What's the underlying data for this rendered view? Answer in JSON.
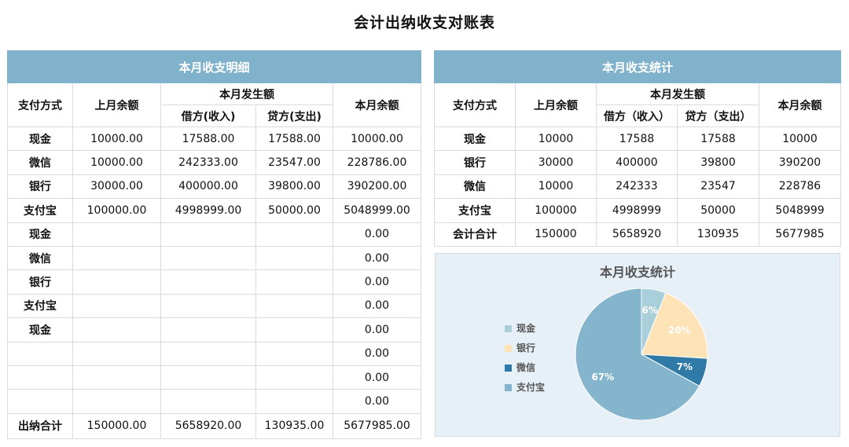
{
  "title": "会计出纳收支对账表",
  "left_table": {
    "band": "本月收支明细",
    "headers": {
      "method": "支付方式",
      "prev": "上月余额",
      "occur": "本月发生额",
      "debit": "借方(收入)",
      "credit": "贷方(支出)",
      "balance": "本月余额"
    },
    "rows": [
      {
        "method": "现金",
        "prev": "10000.00",
        "debit": "17588.00",
        "credit": "17588.00",
        "balance": "10000.00"
      },
      {
        "method": "微信",
        "prev": "10000.00",
        "debit": "242333.00",
        "credit": "23547.00",
        "balance": "228786.00"
      },
      {
        "method": "银行",
        "prev": "30000.00",
        "debit": "400000.00",
        "credit": "39800.00",
        "balance": "390200.00"
      },
      {
        "method": "支付宝",
        "prev": "100000.00",
        "debit": "4998999.00",
        "credit": "50000.00",
        "balance": "5048999.00"
      },
      {
        "method": "现金",
        "prev": "",
        "debit": "",
        "credit": "",
        "balance": "0.00"
      },
      {
        "method": "微信",
        "prev": "",
        "debit": "",
        "credit": "",
        "balance": "0.00"
      },
      {
        "method": "银行",
        "prev": "",
        "debit": "",
        "credit": "",
        "balance": "0.00"
      },
      {
        "method": "支付宝",
        "prev": "",
        "debit": "",
        "credit": "",
        "balance": "0.00"
      },
      {
        "method": "现金",
        "prev": "",
        "debit": "",
        "credit": "",
        "balance": "0.00"
      },
      {
        "method": "",
        "prev": "",
        "debit": "",
        "credit": "",
        "balance": "0.00"
      },
      {
        "method": "",
        "prev": "",
        "debit": "",
        "credit": "",
        "balance": "0.00"
      },
      {
        "method": "",
        "prev": "",
        "debit": "",
        "credit": "",
        "balance": "0.00"
      }
    ],
    "total": {
      "method": "出纳合计",
      "prev": "150000.00",
      "debit": "5658920.00",
      "credit": "130935.00",
      "balance": "5677985.00"
    }
  },
  "right_table": {
    "band": "本月收支统计",
    "headers": {
      "method": "支付方式",
      "prev": "上月余额",
      "occur": "本月发生额",
      "debit": "借方（收入）",
      "credit": "贷方（支出）",
      "balance": "本月余额"
    },
    "rows": [
      {
        "method": "现金",
        "prev": "10000",
        "debit": "17588",
        "credit": "17588",
        "balance": "10000"
      },
      {
        "method": "银行",
        "prev": "30000",
        "debit": "400000",
        "credit": "39800",
        "balance": "390200"
      },
      {
        "method": "微信",
        "prev": "10000",
        "debit": "242333",
        "credit": "23547",
        "balance": "228786"
      },
      {
        "method": "支付宝",
        "prev": "100000",
        "debit": "4998999",
        "credit": "50000",
        "balance": "5048999"
      },
      {
        "method": "会计合计",
        "prev": "150000",
        "debit": "5658920",
        "credit": "130935",
        "balance": "5677985"
      }
    ]
  },
  "chart_data": {
    "type": "pie",
    "title": "本月收支统计",
    "categories": [
      "现金",
      "银行",
      "微信",
      "支付宝"
    ],
    "values": [
      6,
      20,
      7,
      67
    ],
    "labels": [
      "6%",
      "20%",
      "7%",
      "67%"
    ],
    "colors": [
      "#a9cfdb",
      "#fde3b6",
      "#2f7aa6",
      "#84b5cc"
    ],
    "legend_position": "left"
  }
}
